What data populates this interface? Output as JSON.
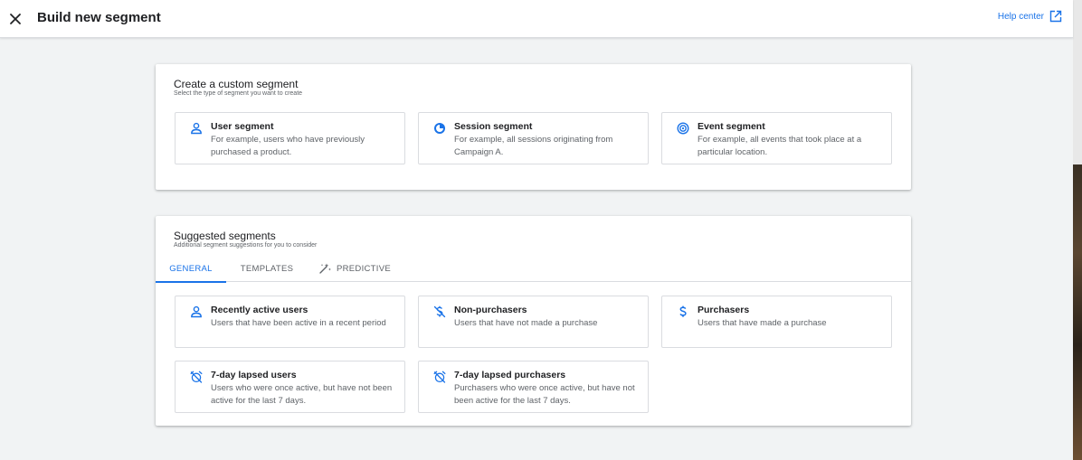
{
  "header": {
    "title": "Build new segment",
    "help_label": "Help center"
  },
  "custom": {
    "title": "Create a custom segment",
    "subtitle": "Select the type of segment you want to create",
    "options": [
      {
        "icon": "person-icon",
        "title": "User segment",
        "desc": "For example, users who have previously purchased a product."
      },
      {
        "icon": "session-icon",
        "title": "Session segment",
        "desc": "For example, all sessions originating from Campaign A."
      },
      {
        "icon": "event-icon",
        "title": "Event segment",
        "desc": "For example, all events that took place at a particular location."
      }
    ]
  },
  "suggested": {
    "title": "Suggested segments",
    "subtitle": "Additional segment suggestions for you to consider",
    "tabs": [
      {
        "label": "GENERAL",
        "active": true
      },
      {
        "label": "TEMPLATES",
        "active": false
      },
      {
        "label": "PREDICTIVE",
        "active": false,
        "icon": "magic-wand-icon"
      }
    ],
    "options": [
      {
        "icon": "person-icon",
        "title": "Recently active users",
        "desc": "Users that have been active in a recent period"
      },
      {
        "icon": "no-purchase-icon",
        "title": "Non-purchasers",
        "desc": "Users that have not made a purchase"
      },
      {
        "icon": "dollar-icon",
        "title": "Purchasers",
        "desc": "Users that have made a purchase"
      },
      {
        "icon": "alarm-off-icon",
        "title": "7-day lapsed users",
        "desc": "Users who were once active, but have not been active for the last 7 days."
      },
      {
        "icon": "alarm-off-icon",
        "title": "7-day lapsed purchasers",
        "desc": "Purchasers who were once active, but have not been active for the last 7 days."
      }
    ]
  },
  "colors": {
    "accent": "#1a73e8",
    "background": "#f1f3f4",
    "card": "#ffffff",
    "text": "#202124",
    "muted": "#5f6368"
  }
}
